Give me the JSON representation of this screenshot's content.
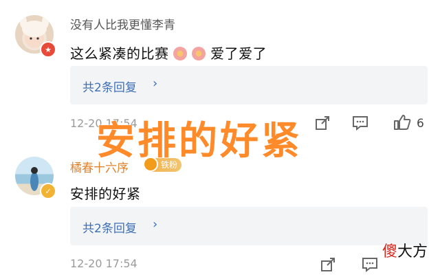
{
  "comments": [
    {
      "username": "没有人比我更懂李青",
      "text": "这么紧凑的比赛",
      "text_suffix": "爱了爱了",
      "replies_label": "共2条回复",
      "timestamp": "12-20 17:54",
      "likes": "6"
    },
    {
      "username": "橘春十六序",
      "fan_badge": "铁粉",
      "text": "安排的好紧",
      "replies_label": "共2条回复",
      "timestamp": "12-20 17:54"
    }
  ],
  "overlay_caption": "安排的好紧",
  "watermark": {
    "accent": "傻",
    "rest": "大方"
  },
  "colors": {
    "link": "#3d6fb6",
    "overlay": "#ff8a2a",
    "username_fan": "#e0822a"
  },
  "icons": [
    "chevron-right-icon",
    "share-icon",
    "comment-icon",
    "like-icon",
    "verified-icon",
    "hat-badge-icon",
    "flower-emoji-icon"
  ]
}
